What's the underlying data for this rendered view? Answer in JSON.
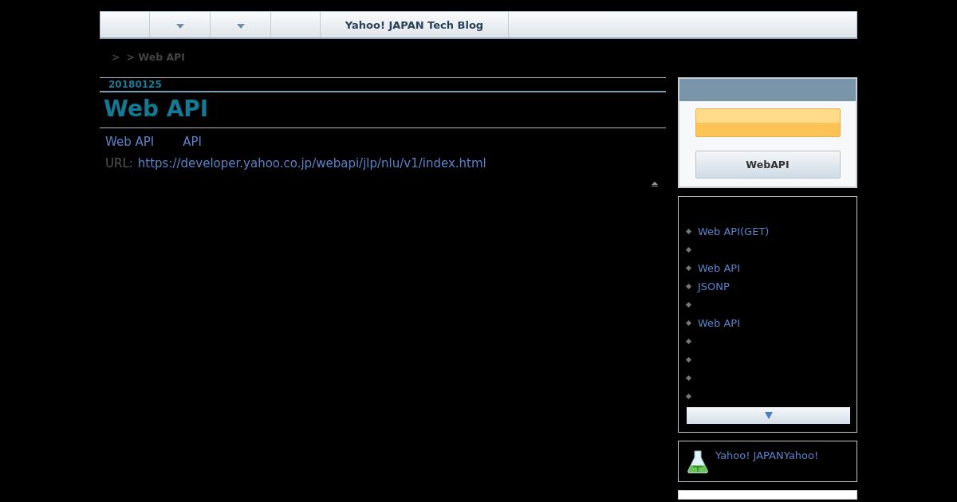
{
  "nav": [
    {
      "kind": "plain"
    },
    {
      "kind": "dropdown"
    },
    {
      "kind": "dropdown"
    },
    {
      "kind": "plain"
    },
    {
      "kind": "title",
      "label": "Yahoo! JAPAN Tech Blog"
    },
    {
      "kind": "fill"
    }
  ],
  "breadcrumb": [
    ">",
    "> Web API"
  ],
  "entry": {
    "date": "20180125",
    "title": "Web API",
    "links": [
      "Web API",
      "API"
    ],
    "url_label": "URL:",
    "url": "https://developer.yahoo.co.jp/webapi/jlp/nlu/v1/index.html"
  },
  "profile": {
    "button": "WebAPI"
  },
  "recent": {
    "items": [
      {
        "kind": "link",
        "label": "Web API(GET)"
      },
      {
        "kind": "blank"
      },
      {
        "kind": "link",
        "label": "Web API"
      },
      {
        "kind": "link",
        "label": "JSONP"
      },
      {
        "kind": "blank"
      },
      {
        "kind": "link",
        "label": "Web API"
      },
      {
        "kind": "blank"
      },
      {
        "kind": "blank"
      },
      {
        "kind": "blank"
      },
      {
        "kind": "blank"
      }
    ]
  },
  "about": {
    "text": "Yahoo! JAPANYahoo!"
  }
}
